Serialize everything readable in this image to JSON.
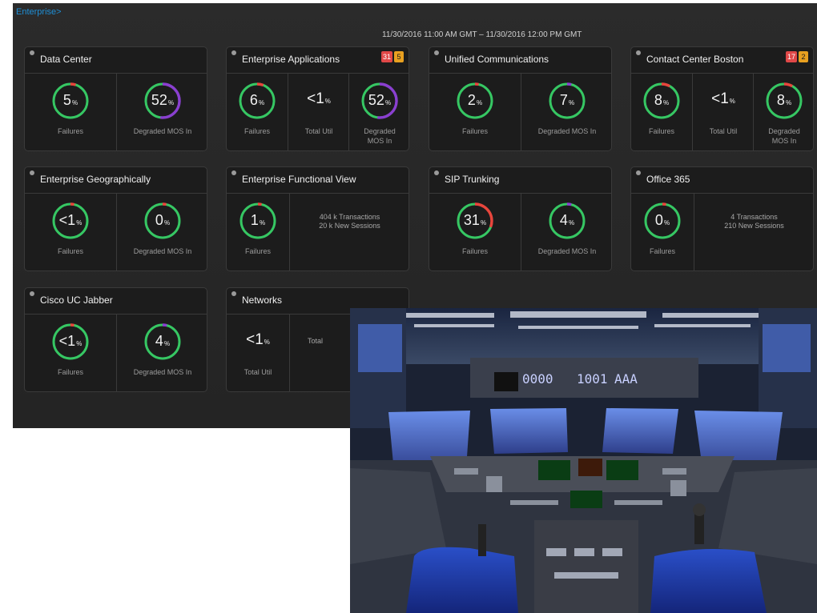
{
  "breadcrumb": "Enterprise>",
  "date_range": "11/30/2016 11:00 AM GMT – 11/30/2016 12:00 PM GMT",
  "colors": {
    "ring_green": "#36c763",
    "ring_red": "#e8453c",
    "ring_purple": "#8a3fd0",
    "badge_red": "#e04848",
    "badge_orange": "#e8a020",
    "link_blue": "#1f8fd6"
  },
  "tiles": [
    {
      "title": "Data Center",
      "badges": [],
      "metrics": [
        {
          "value": "5",
          "unit": "%",
          "label": "Failures"
        },
        {
          "value": "52",
          "unit": "%",
          "label": "Degraded MOS In"
        }
      ]
    },
    {
      "title": "Enterprise Applications",
      "badges": [
        "31",
        "5"
      ],
      "metrics": [
        {
          "value": "6",
          "unit": "%",
          "label": "Failures"
        },
        {
          "value": "<1",
          "unit": "%",
          "label": "Total Util"
        },
        {
          "value": "52",
          "unit": "%",
          "label": "Degraded MOS In"
        }
      ]
    },
    {
      "title": "Unified Communications",
      "badges": [],
      "metrics": [
        {
          "value": "2",
          "unit": "%",
          "label": "Failures"
        },
        {
          "value": "7",
          "unit": "%",
          "label": "Degraded MOS In"
        }
      ]
    },
    {
      "title": "Contact Center Boston",
      "badges": [
        "17",
        "2"
      ],
      "metrics": [
        {
          "value": "8",
          "unit": "%",
          "label": "Failures"
        },
        {
          "value": "<1",
          "unit": "%",
          "label": "Total Util"
        },
        {
          "value": "8",
          "unit": "%",
          "label": "Degraded MOS In"
        }
      ]
    },
    {
      "title": "Enterprise Geographically",
      "badges": [],
      "metrics": [
        {
          "value": "<1",
          "unit": "%",
          "label": "Failures"
        },
        {
          "value": "0",
          "unit": "%",
          "label": "Degraded MOS In"
        }
      ]
    },
    {
      "title": "Enterprise Functional View",
      "badges": [],
      "metrics": [
        {
          "value": "1",
          "unit": "%",
          "label": "Failures"
        }
      ],
      "info": [
        "404 k Transactions",
        "20 k New Sessions"
      ]
    },
    {
      "title": "SIP Trunking",
      "badges": [],
      "metrics": [
        {
          "value": "31",
          "unit": "%",
          "label": "Failures"
        },
        {
          "value": "4",
          "unit": "%",
          "label": "Degraded MOS In"
        }
      ]
    },
    {
      "title": "Office 365",
      "badges": [],
      "metrics": [
        {
          "value": "0",
          "unit": "%",
          "label": "Failures"
        }
      ],
      "info": [
        "4 Transactions",
        "210 New Sessions"
      ]
    },
    {
      "title": "Cisco UC Jabber",
      "badges": [],
      "metrics": [
        {
          "value": "<1",
          "unit": "%",
          "label": "Failures"
        },
        {
          "value": "4",
          "unit": "%",
          "label": "Degraded MOS In"
        }
      ]
    },
    {
      "title": "Networks",
      "badges": [],
      "metrics": [
        {
          "value": "<1",
          "unit": "%",
          "label": "Total Util"
        }
      ],
      "info": [
        "Total"
      ]
    }
  ]
}
